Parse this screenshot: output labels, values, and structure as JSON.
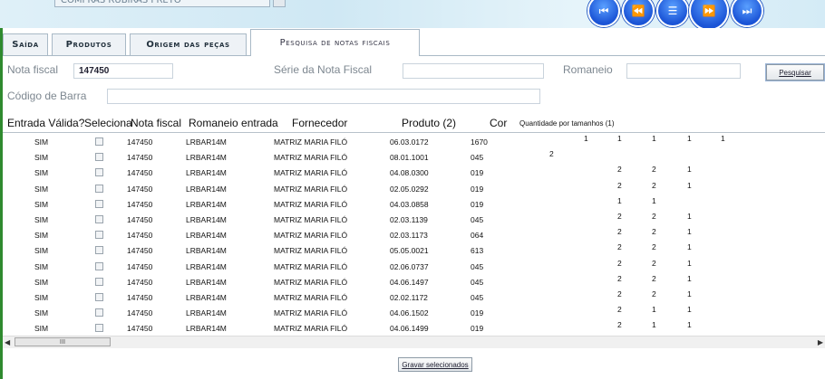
{
  "toolbar": {
    "combo_value": "COMPRAS RUBIRAS PRETO",
    "nav_icons": [
      "first-icon",
      "previous-icon",
      "menu-icon",
      "play-icon",
      "last-icon"
    ]
  },
  "tabs": [
    {
      "label": "Saída",
      "active": false
    },
    {
      "label": "Produtos",
      "active": false
    },
    {
      "label": "Origem das peças",
      "active": false
    },
    {
      "label": "Pesquisa de notas fiscais",
      "active": true
    }
  ],
  "form": {
    "nota_fiscal_label": "Nota fiscal",
    "nota_fiscal_value": "147450",
    "serie_label": "Série da Nota Fiscal",
    "serie_value": "",
    "romaneio_label": "Romaneio",
    "romaneio_value": "",
    "codigo_label": "Código de Barra",
    "codigo_value": "",
    "pesquisar_label": "Pesquisar"
  },
  "table": {
    "columns": [
      "Entrada Válida?",
      "Seleciona",
      "Nota fiscal",
      "Romaneio entrada",
      "Fornecedor",
      "Produto (2)",
      "Cor",
      "Quantidade por tamanhos (1)"
    ],
    "rows": [
      {
        "valida": "SIM",
        "nota": "147450",
        "romaneio": "LRBAR14M",
        "fornecedor": "MATRIZ MARIA FILÓ",
        "produto": "06.03.0172",
        "cor": "1670",
        "qtd": [
          "1",
          "1",
          "1",
          "1",
          "1"
        ]
      },
      {
        "valida": "SIM",
        "nota": "147450",
        "romaneio": "LRBAR14M",
        "fornecedor": "MATRIZ MARIA FILÓ",
        "produto": "08.01.1001",
        "cor": "045",
        "qtd": [
          "2",
          "",
          "",
          "",
          ""
        ]
      },
      {
        "valida": "SIM",
        "nota": "147450",
        "romaneio": "LRBAR14M",
        "fornecedor": "MATRIZ MARIA FILÓ",
        "produto": "04.08.0300",
        "cor": "019",
        "qtd": [
          "",
          "2",
          "2",
          "1",
          ""
        ]
      },
      {
        "valida": "SIM",
        "nota": "147450",
        "romaneio": "LRBAR14M",
        "fornecedor": "MATRIZ MARIA FILÓ",
        "produto": "02.05.0292",
        "cor": "019",
        "qtd": [
          "",
          "2",
          "2",
          "1",
          ""
        ]
      },
      {
        "valida": "SIM",
        "nota": "147450",
        "romaneio": "LRBAR14M",
        "fornecedor": "MATRIZ MARIA FILÓ",
        "produto": "04.03.0858",
        "cor": "019",
        "qtd": [
          "",
          "1",
          "1",
          "",
          ""
        ]
      },
      {
        "valida": "SIM",
        "nota": "147450",
        "romaneio": "LRBAR14M",
        "fornecedor": "MATRIZ MARIA FILÓ",
        "produto": "02.03.1139",
        "cor": "045",
        "qtd": [
          "",
          "2",
          "2",
          "1",
          ""
        ]
      },
      {
        "valida": "SIM",
        "nota": "147450",
        "romaneio": "LRBAR14M",
        "fornecedor": "MATRIZ MARIA FILÓ",
        "produto": "02.03.1173",
        "cor": "064",
        "qtd": [
          "",
          "2",
          "2",
          "1",
          ""
        ]
      },
      {
        "valida": "SIM",
        "nota": "147450",
        "romaneio": "LRBAR14M",
        "fornecedor": "MATRIZ MARIA FILÓ",
        "produto": "05.05.0021",
        "cor": "613",
        "qtd": [
          "",
          "2",
          "2",
          "1",
          ""
        ]
      },
      {
        "valida": "SIM",
        "nota": "147450",
        "romaneio": "LRBAR14M",
        "fornecedor": "MATRIZ MARIA FILÓ",
        "produto": "02.06.0737",
        "cor": "045",
        "qtd": [
          "",
          "2",
          "2",
          "1",
          ""
        ]
      },
      {
        "valida": "SIM",
        "nota": "147450",
        "romaneio": "LRBAR14M",
        "fornecedor": "MATRIZ MARIA FILÓ",
        "produto": "04.06.1497",
        "cor": "045",
        "qtd": [
          "",
          "2",
          "2",
          "1",
          ""
        ]
      },
      {
        "valida": "SIM",
        "nota": "147450",
        "romaneio": "LRBAR14M",
        "fornecedor": "MATRIZ MARIA FILÓ",
        "produto": "02.02.1172",
        "cor": "045",
        "qtd": [
          "",
          "2",
          "2",
          "1",
          ""
        ]
      },
      {
        "valida": "SIM",
        "nota": "147450",
        "romaneio": "LRBAR14M",
        "fornecedor": "MATRIZ MARIA FILÓ",
        "produto": "04.06.1502",
        "cor": "019",
        "qtd": [
          "",
          "2",
          "1",
          "1",
          ""
        ]
      },
      {
        "valida": "SIM",
        "nota": "147450",
        "romaneio": "LRBAR14M",
        "fornecedor": "MATRIZ MARIA FILÓ",
        "produto": "04.06.1499",
        "cor": "019",
        "qtd": [
          "",
          "2",
          "1",
          "1",
          ""
        ]
      }
    ]
  },
  "scrollbar": {
    "thumb_label": "III"
  },
  "footer": {
    "gravar_label": "Gravar selecionados"
  },
  "colors": {
    "accent": "#1b54d6",
    "sidebar_green": "#2f8a2f"
  }
}
